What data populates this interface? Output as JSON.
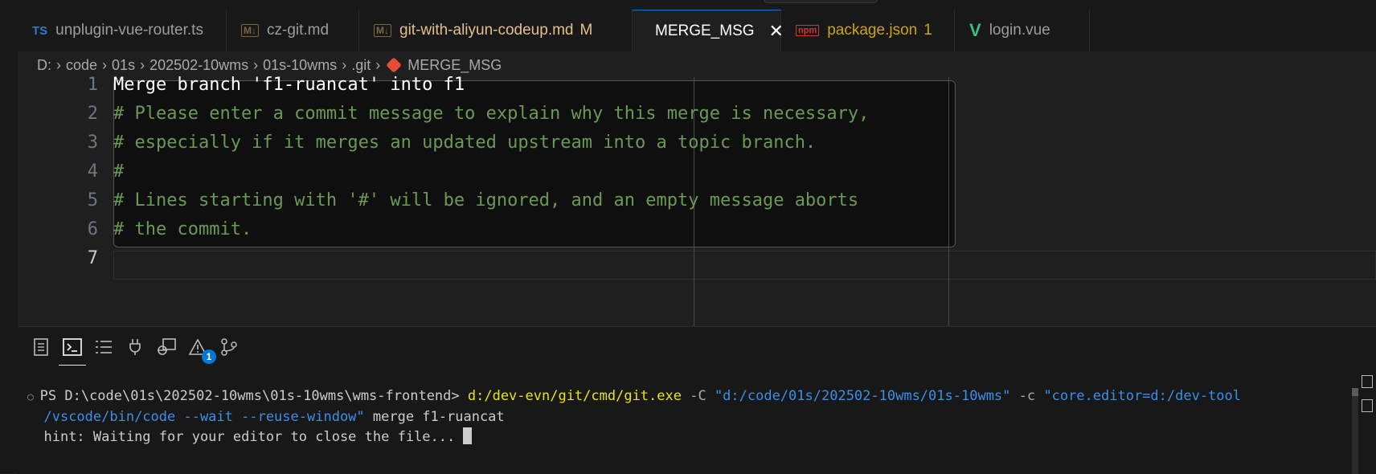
{
  "tabs": [
    {
      "icon": "TS",
      "label": "unplugin-vue-router.ts"
    },
    {
      "icon": "M↓",
      "label": "cz-git.md"
    },
    {
      "icon": "M↓",
      "label": "git-with-aliyun-codeup.md",
      "status": "M"
    },
    {
      "icon": "git",
      "label": "MERGE_MSG",
      "close": "✕"
    },
    {
      "icon": "npm",
      "label": "package.json",
      "problems": "1"
    },
    {
      "icon": "V",
      "label": "login.vue"
    }
  ],
  "breadcrumb": [
    "D:",
    "code",
    "01s",
    "202502-10wms",
    "01s-10wms",
    ".git",
    "MERGE_MSG"
  ],
  "editor": {
    "lines": [
      {
        "n": "1",
        "text": "Merge branch 'f1-ruancat' into f1",
        "kind": "plain"
      },
      {
        "n": "2",
        "text": "# Please enter a commit message to explain why this merge is necessary,",
        "kind": "comment"
      },
      {
        "n": "3",
        "text": "# especially if it merges an updated upstream into a topic branch.",
        "kind": "comment"
      },
      {
        "n": "4",
        "text": "#",
        "kind": "comment"
      },
      {
        "n": "5",
        "text": "# Lines starting with '#' will be ignored, and an empty message aborts",
        "kind": "comment"
      },
      {
        "n": "6",
        "text": "# the commit.",
        "kind": "comment"
      },
      {
        "n": "7",
        "text": "",
        "kind": "plain"
      }
    ]
  },
  "panel": {
    "problems_badge": "1",
    "terminal": {
      "prompt": "PS D:\\code\\01s\\202502-10wms\\01s-10wms\\wms-frontend> ",
      "exe": "d:/dev-evn/git/cmd/git.exe",
      "flag_c_upper": " -C ",
      "path_arg": "\"d:/code/01s/202502-10wms/01s-10wms\"",
      "flag_c": " -c ",
      "editor_arg_1": "\"core.editor=d:/dev-tool",
      "editor_arg_2": "/vscode/bin/code --wait --reuse-window\"",
      "merge_cmd": " merge f1-ruancat",
      "hint": "hint: Waiting for your editor to close the file... "
    }
  },
  "colors": {
    "accent": "#0078d4",
    "comment": "#6a9955",
    "warning": "#cca700",
    "modified": "#e2c08d"
  }
}
